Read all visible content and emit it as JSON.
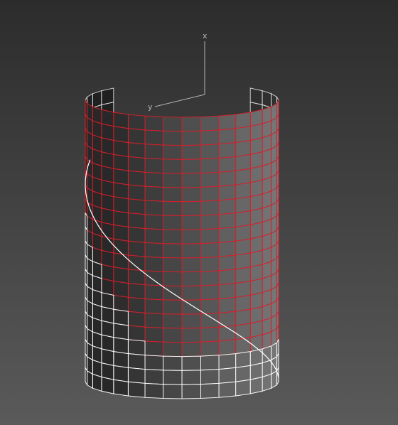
{
  "viewport": {
    "axes": {
      "x_label": "x",
      "y_label": "y"
    },
    "mesh": {
      "rows": 20,
      "cols": 24,
      "arc_span_degrees": 270,
      "selected_rows": 17
    },
    "colors": {
      "background_top": "#2c2c2c",
      "background_bottom": "#5a5a5a",
      "wire_unselected": "#ffffff",
      "wire_selected": "#d81d2a",
      "surface_light": "#6e6e6e",
      "surface_dark": "#101010",
      "axis": "#b4b4b4"
    }
  }
}
